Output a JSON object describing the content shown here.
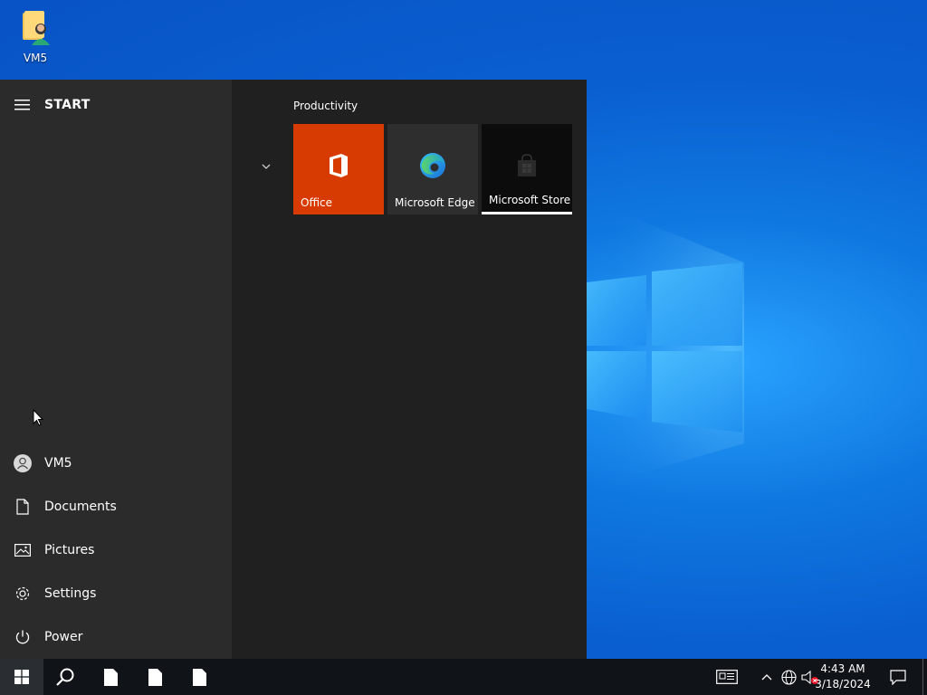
{
  "desktop": {
    "icons": [
      {
        "label": "VM5",
        "icon": "user-folder-icon"
      }
    ]
  },
  "start_menu": {
    "title": "START",
    "rail": [
      {
        "label": "VM5",
        "icon": "user-avatar-icon"
      },
      {
        "label": "Documents",
        "icon": "document-icon"
      },
      {
        "label": "Pictures",
        "icon": "picture-icon"
      },
      {
        "label": "Settings",
        "icon": "gear-icon"
      },
      {
        "label": "Power",
        "icon": "power-icon"
      }
    ],
    "group": {
      "title": "Productivity",
      "tiles": [
        {
          "label": "Office",
          "icon": "office-icon",
          "color": "#d83b01"
        },
        {
          "label": "Microsoft Edge",
          "icon": "edge-icon",
          "color": "#2e2e2e"
        },
        {
          "label": "Microsoft Store",
          "icon": "store-icon",
          "color": "#0c0c0c"
        }
      ]
    }
  },
  "taskbar": {
    "clock": {
      "time": "4:43 AM",
      "date": "3/18/2024"
    }
  },
  "colors": {
    "accent_office": "#d83b01",
    "menu_bg": "#202020",
    "rail_bg": "#2b2b2b",
    "taskbar_bg": "#101418"
  }
}
